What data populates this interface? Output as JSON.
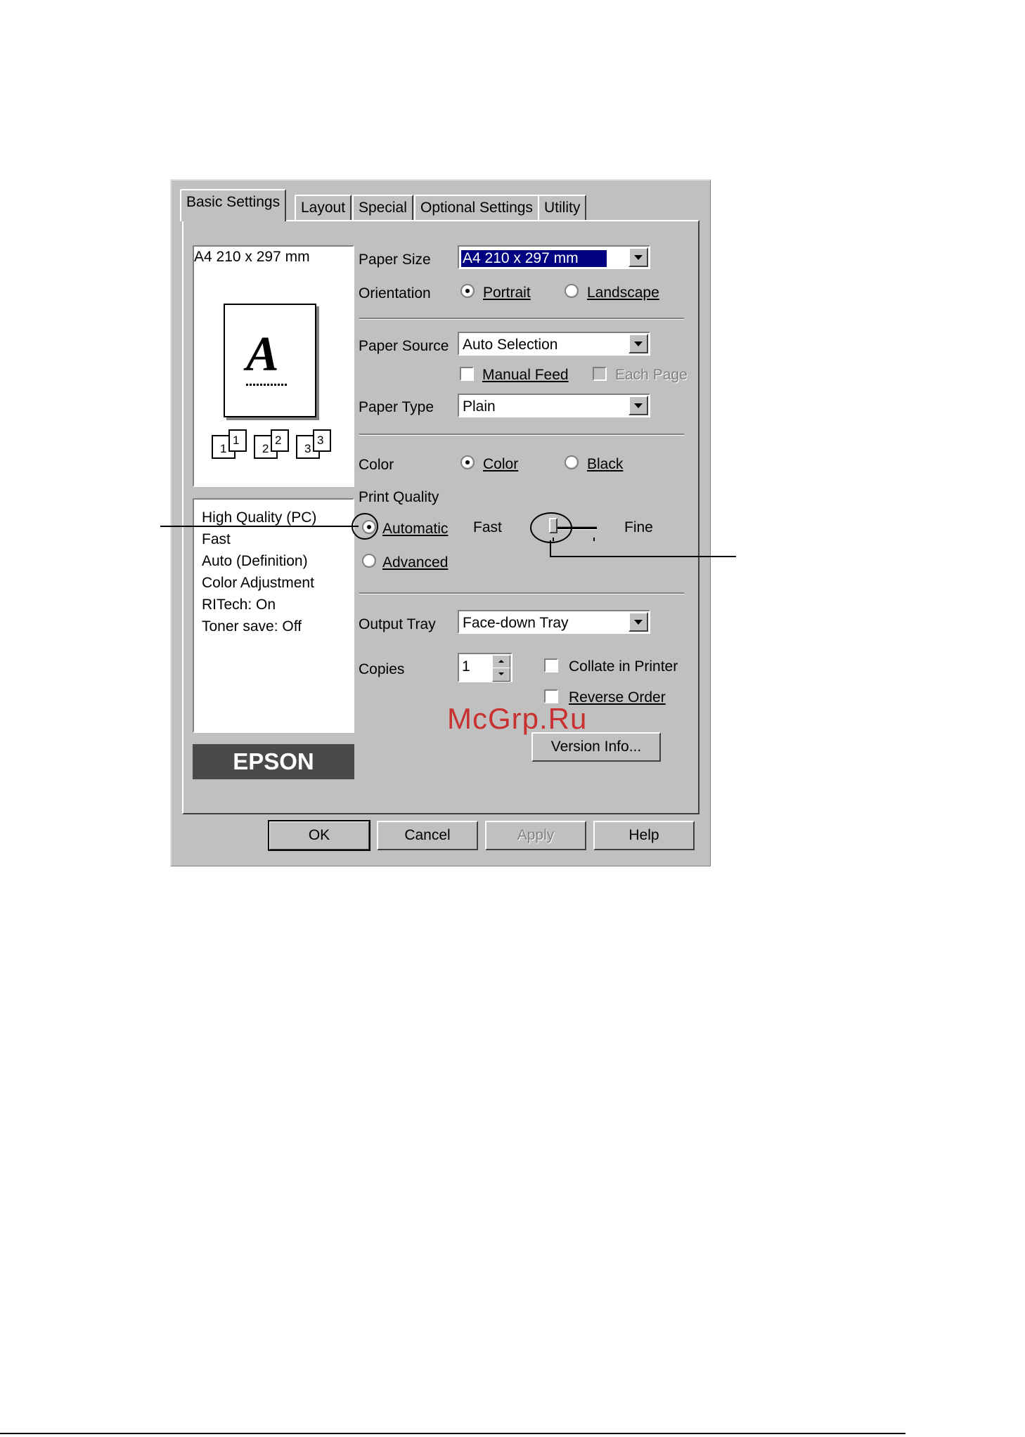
{
  "tabs": [
    "Basic Settings",
    "Layout",
    "Special",
    "Optional Settings",
    "Utility"
  ],
  "preview": {
    "paper_label": "A4 210 x 297 mm",
    "letter": "A",
    "collate_pages": [
      "1",
      "2",
      "3"
    ]
  },
  "summary": [
    "High Quality (PC)",
    "Fast",
    "Auto (Definition)",
    "Color Adjustment",
    "RITech: On",
    "Toner save: Off"
  ],
  "logo": "EPSON",
  "paper_size": {
    "label": "Paper Size",
    "value": "A4 210 x 297 mm"
  },
  "orientation": {
    "label": "Orientation",
    "portrait": "Portrait",
    "landscape": "Landscape",
    "selected": "Portrait"
  },
  "paper_source": {
    "label": "Paper Source",
    "value": "Auto Selection",
    "manual_feed": "Manual Feed",
    "each_page": "Each Page"
  },
  "paper_type": {
    "label": "Paper Type",
    "value": "Plain"
  },
  "color": {
    "label": "Color",
    "color_option": "Color",
    "black_option": "Black",
    "selected": "Color"
  },
  "print_quality": {
    "label": "Print Quality",
    "automatic": "Automatic",
    "advanced": "Advanced",
    "selected": "Automatic",
    "fast_label": "Fast",
    "fine_label": "Fine",
    "slider_level": 0
  },
  "output_tray": {
    "label": "Output Tray",
    "value": "Face-down Tray"
  },
  "copies": {
    "label": "Copies",
    "value": "1",
    "collate": "Collate in Printer",
    "reverse": "Reverse Order"
  },
  "version_button": "Version Info...",
  "buttons": {
    "ok": "OK",
    "cancel": "Cancel",
    "apply": "Apply",
    "help": "Help"
  },
  "watermark": "McGrp.Ru",
  "colors": {
    "dialog_bg": "#c0c0c0",
    "selection": "#000080",
    "logo_bg": "#4a4a4a",
    "watermark": "#cc0000"
  }
}
